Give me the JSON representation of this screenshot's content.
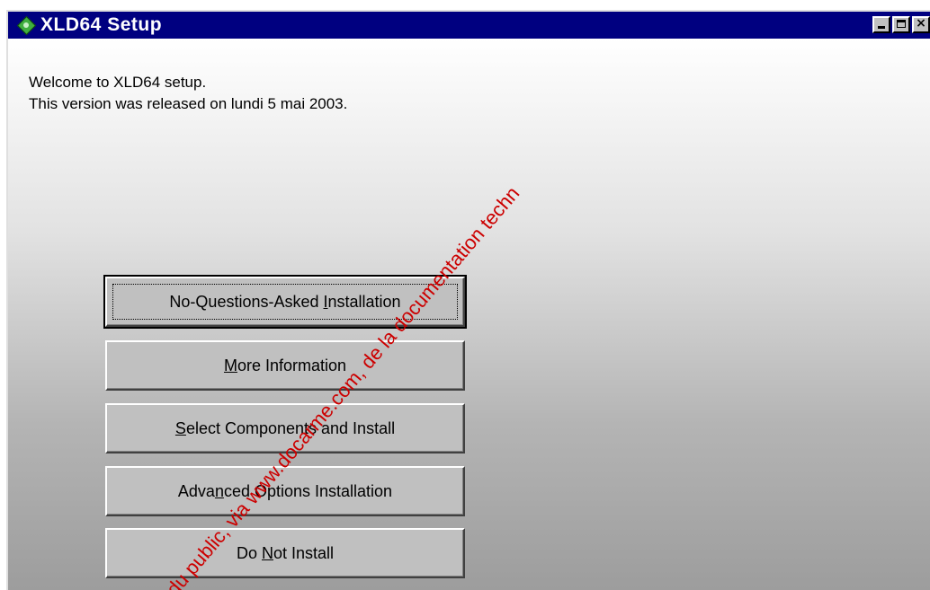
{
  "window": {
    "title": "XLD64 Setup",
    "icon": "xld64-app-icon",
    "controls": [
      "minimize-icon",
      "maximize-icon",
      "close-icon"
    ]
  },
  "welcome": {
    "line1": "Welcome to XLD64 setup.",
    "line2": "This version was released on lundi 5 mai 2003."
  },
  "buttons": [
    {
      "pre": "No-Questions-Asked ",
      "ul": "I",
      "post": "nstallation",
      "default": true
    },
    {
      "pre": "",
      "ul": "M",
      "post": "ore Information",
      "default": false
    },
    {
      "pre": "",
      "ul": "S",
      "post": "elect Components and Install",
      "default": false
    },
    {
      "pre": "Adva",
      "ul": "n",
      "post": "ced Options Installation",
      "default": false
    },
    {
      "pre": "Do ",
      "ul": "N",
      "post": "ot Install",
      "default": false
    }
  ],
  "watermark": {
    "text": "du public, via www.docarme.com, de la documentation techn",
    "color": "#cc0000"
  }
}
